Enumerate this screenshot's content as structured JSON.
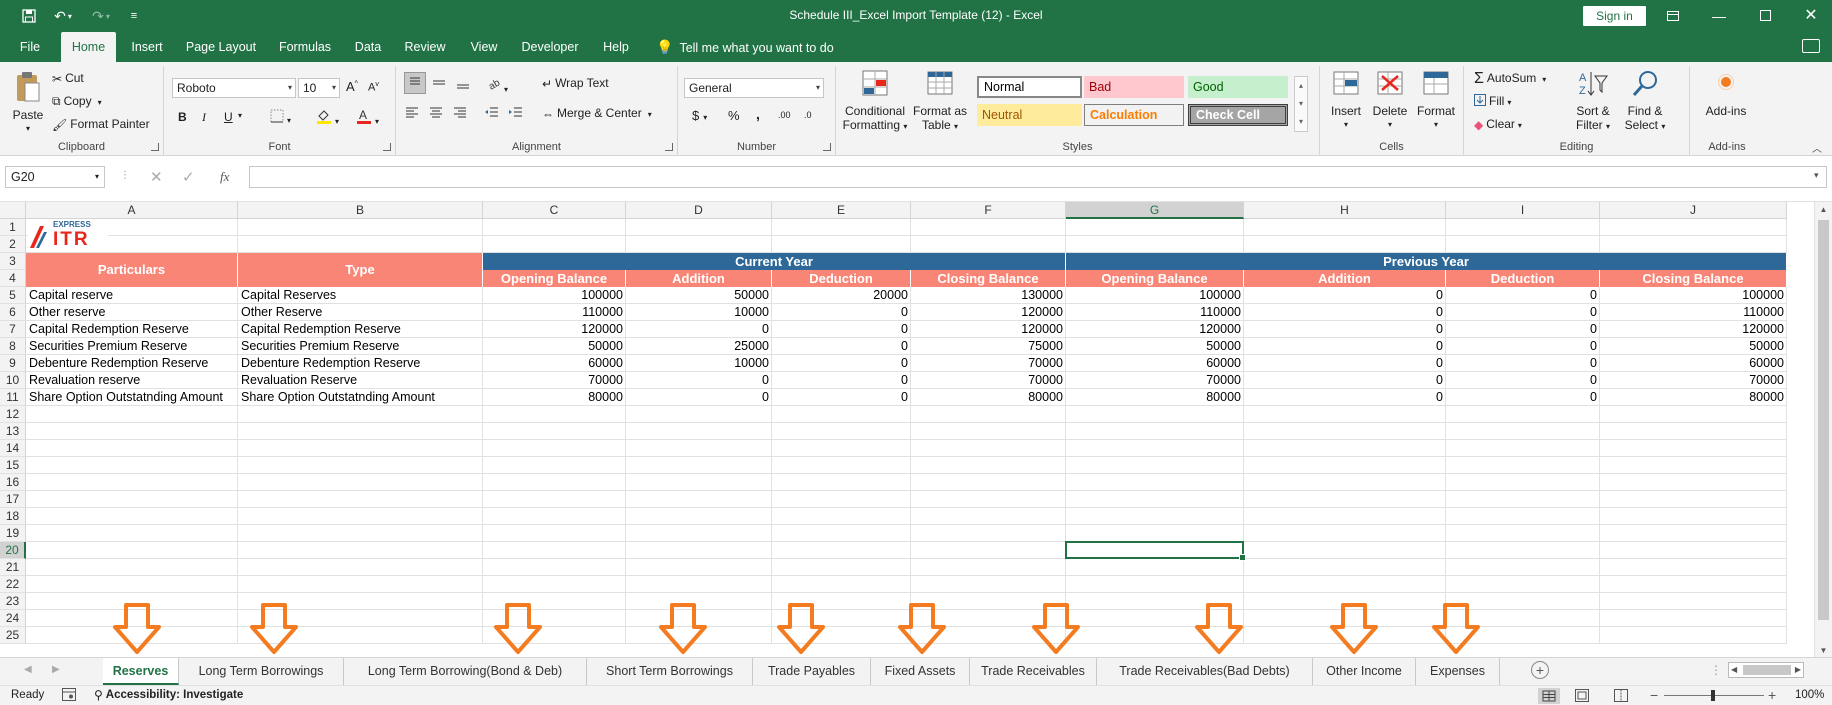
{
  "window": {
    "title": "Schedule III_Excel Import Template (12)  -  Excel",
    "sign_in": "Sign in"
  },
  "menu": {
    "tabs": [
      "File",
      "Home",
      "Insert",
      "Page Layout",
      "Formulas",
      "Data",
      "Review",
      "View",
      "Developer",
      "Help"
    ],
    "active": "Home",
    "tell_me": "Tell me what you want to do"
  },
  "ribbon": {
    "clipboard": {
      "label": "Clipboard",
      "paste": "Paste",
      "cut": "Cut",
      "copy": "Copy",
      "format_painter": "Format Painter"
    },
    "font": {
      "label": "Font",
      "name": "Roboto",
      "size": "10",
      "bold": "B",
      "italic": "I",
      "underline": "U"
    },
    "alignment": {
      "label": "Alignment",
      "wrap_text": "Wrap Text",
      "merge_center": "Merge & Center"
    },
    "number": {
      "label": "Number",
      "format": "General",
      "currency": "$",
      "percent": "%",
      "comma": ",",
      "inc_dec": ".00",
      "dec_dec": ".0"
    },
    "styles": {
      "label": "Styles",
      "conditional_1": "Conditional",
      "conditional_2": "Formatting",
      "format_table_1": "Format as",
      "format_table_2": "Table",
      "normal": "Normal",
      "bad": "Bad",
      "good": "Good",
      "neutral": "Neutral",
      "calculation": "Calculation",
      "check_cell": "Check Cell"
    },
    "cells": {
      "label": "Cells",
      "insert": "Insert",
      "delete": "Delete",
      "format": "Format"
    },
    "editing": {
      "label": "Editing",
      "autosum": "AutoSum",
      "fill": "Fill",
      "clear": "Clear",
      "sort_1": "Sort &",
      "sort_2": "Filter",
      "find_1": "Find &",
      "find_2": "Select"
    },
    "addins": {
      "label": "Add-ins",
      "addins": "Add-ins"
    }
  },
  "formula_bar": {
    "name_box": "G20",
    "fx": "fx",
    "value": ""
  },
  "sheet": {
    "columns": [
      "A",
      "B",
      "C",
      "D",
      "E",
      "F",
      "G",
      "H",
      "I",
      "J"
    ],
    "selected_column": "G",
    "rows": [
      "1",
      "2",
      "3",
      "4",
      "5",
      "6",
      "7",
      "8",
      "9",
      "10",
      "11",
      "12",
      "13",
      "14",
      "15",
      "16",
      "17",
      "18",
      "19",
      "20",
      "21",
      "22",
      "23",
      "24",
      "25"
    ],
    "selected_row": "20",
    "logo_top": "EXPRESS",
    "logo_main": "ITR",
    "header_particulars": "Particulars",
    "header_type": "Type",
    "current_year": "Current Year",
    "previous_year": "Previous Year",
    "sub_headers": [
      "Opening Balance",
      "Addition",
      "Deduction",
      "Closing Balance",
      "Opening Balance",
      "Addition",
      "Deduction",
      "Closing Balance"
    ],
    "data": [
      [
        "Capital reserve",
        "Capital Reserves",
        "100000",
        "50000",
        "20000",
        "130000",
        "100000",
        "0",
        "0",
        "100000"
      ],
      [
        "Other reserve",
        "Other Reserve",
        "110000",
        "10000",
        "0",
        "120000",
        "110000",
        "0",
        "0",
        "110000"
      ],
      [
        "Capital Redemption Reserve",
        "Capital Redemption Reserve",
        "120000",
        "0",
        "0",
        "120000",
        "120000",
        "0",
        "0",
        "120000"
      ],
      [
        "Securities Premium Reserve",
        "Securities Premium Reserve",
        "50000",
        "25000",
        "0",
        "75000",
        "50000",
        "0",
        "0",
        "50000"
      ],
      [
        "Debenture Redemption Reserve",
        "Debenture Redemption Reserve",
        "60000",
        "10000",
        "0",
        "70000",
        "60000",
        "0",
        "0",
        "60000"
      ],
      [
        "Revaluation reserve",
        "Revaluation Reserve",
        "70000",
        "0",
        "0",
        "70000",
        "70000",
        "0",
        "0",
        "70000"
      ],
      [
        "Share Option Outstatnding Amount",
        "Share Option Outstatnding Amount",
        "80000",
        "0",
        "0",
        "80000",
        "80000",
        "0",
        "0",
        "80000"
      ]
    ]
  },
  "sheet_tabs": [
    "Reserves",
    "Long Term Borrowings",
    "Long Term Borrowing(Bond & Deb)",
    "Short Term Borrowings",
    "Trade Payables",
    "Fixed Assets",
    "Trade Receivables",
    "Trade Receivables(Bad Debts)",
    "Other Income",
    "Expenses"
  ],
  "active_sheet": "Reserves",
  "status": {
    "ready": "Ready",
    "accessibility": "Accessibility: Investigate",
    "zoom": "100%"
  },
  "colors": {
    "excel_green": "#217346",
    "header_salmon": "#f88576",
    "band_blue": "#2e6898",
    "arrow_orange": "#f47b20"
  }
}
